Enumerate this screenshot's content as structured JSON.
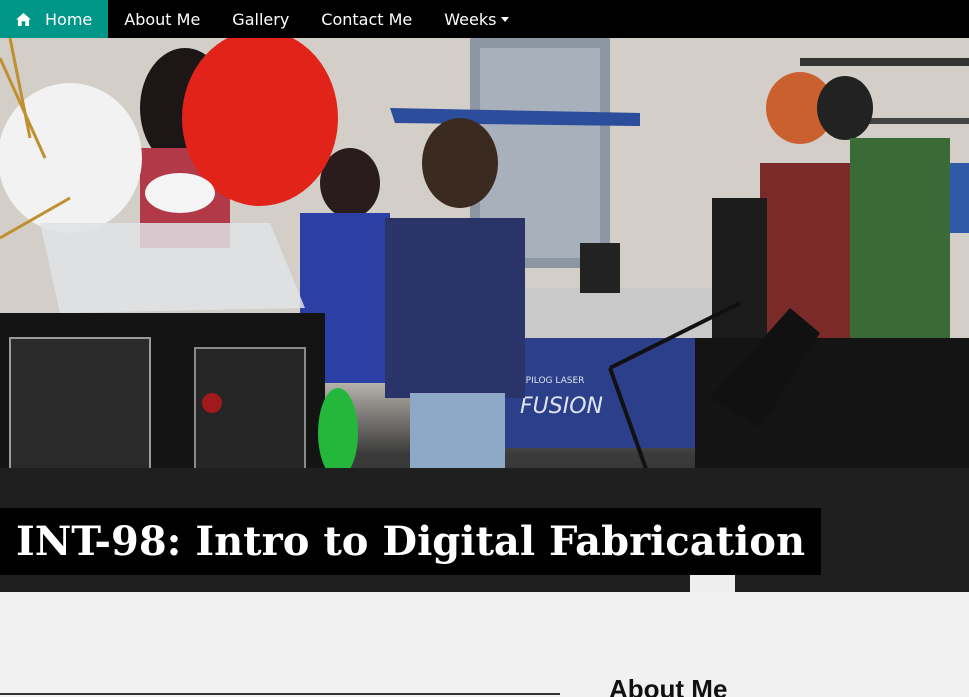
{
  "nav": {
    "items": [
      {
        "label": "Home",
        "icon": "home-icon",
        "active": true
      },
      {
        "label": "About Me"
      },
      {
        "label": "Gallery"
      },
      {
        "label": "Contact Me"
      },
      {
        "label": "Weeks",
        "icon": "caret-down-icon"
      }
    ],
    "active_color": "#009688",
    "bar_color": "#000000"
  },
  "hero": {
    "title": "INT-98: Intro to Digital Fabrication",
    "machine_text_1": "EPILOG LASER",
    "machine_text_2": "FUSION"
  },
  "content": {
    "section_heading": "About Me"
  }
}
